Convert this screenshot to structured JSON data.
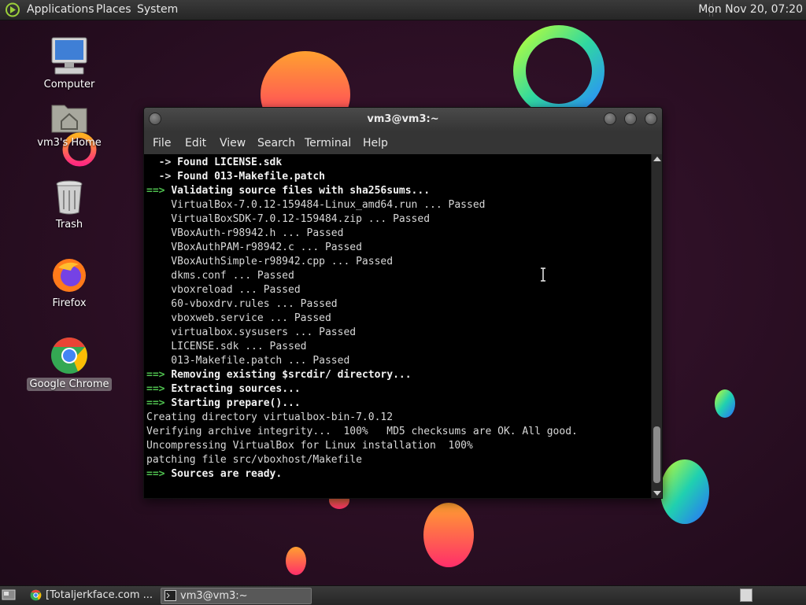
{
  "top_panel": {
    "menus": [
      "Applications",
      "Places",
      "System"
    ],
    "clock": "Mon Nov 20, 07:20"
  },
  "desktop": {
    "icons": [
      {
        "label": "Computer",
        "icon": "computer-icon"
      },
      {
        "label": "vm3's Home",
        "icon": "home-folder-icon"
      },
      {
        "label": "Trash",
        "icon": "trash-icon"
      },
      {
        "label": "Firefox",
        "icon": "firefox-icon"
      },
      {
        "label": "Google Chrome",
        "icon": "chrome-icon",
        "selected": true
      }
    ]
  },
  "terminal": {
    "title": "vm3@vm3:~",
    "menu": [
      "File",
      "Edit",
      "View",
      "Search",
      "Terminal",
      "Help"
    ],
    "lines": [
      {
        "prefix": "  -> ",
        "text": "Found LICENSE.sdk",
        "style": "sub"
      },
      {
        "prefix": "  -> ",
        "text": "Found 013-Makefile.patch",
        "style": "sub"
      },
      {
        "prefix": "==> ",
        "text": "Validating source files with sha256sums...",
        "style": "step"
      },
      {
        "prefix": "",
        "text": "    VirtualBox-7.0.12-159484-Linux_amd64.run ... Passed",
        "style": "plain"
      },
      {
        "prefix": "",
        "text": "    VirtualBoxSDK-7.0.12-159484.zip ... Passed",
        "style": "plain"
      },
      {
        "prefix": "",
        "text": "    VBoxAuth-r98942.h ... Passed",
        "style": "plain"
      },
      {
        "prefix": "",
        "text": "    VBoxAuthPAM-r98942.c ... Passed",
        "style": "plain"
      },
      {
        "prefix": "",
        "text": "    VBoxAuthSimple-r98942.cpp ... Passed",
        "style": "plain"
      },
      {
        "prefix": "",
        "text": "    dkms.conf ... Passed",
        "style": "plain"
      },
      {
        "prefix": "",
        "text": "    vboxreload ... Passed",
        "style": "plain"
      },
      {
        "prefix": "",
        "text": "    60-vboxdrv.rules ... Passed",
        "style": "plain"
      },
      {
        "prefix": "",
        "text": "    vboxweb.service ... Passed",
        "style": "plain"
      },
      {
        "prefix": "",
        "text": "    virtualbox.sysusers ... Passed",
        "style": "plain"
      },
      {
        "prefix": "",
        "text": "    LICENSE.sdk ... Passed",
        "style": "plain"
      },
      {
        "prefix": "",
        "text": "    013-Makefile.patch ... Passed",
        "style": "plain"
      },
      {
        "prefix": "==> ",
        "text": "Removing existing $srcdir/ directory...",
        "style": "step"
      },
      {
        "prefix": "==> ",
        "text": "Extracting sources...",
        "style": "step"
      },
      {
        "prefix": "==> ",
        "text": "Starting prepare()...",
        "style": "step"
      },
      {
        "prefix": "",
        "text": "Creating directory virtualbox-bin-7.0.12",
        "style": "plain"
      },
      {
        "prefix": "",
        "text": "Verifying archive integrity...  100%   MD5 checksums are OK. All good.",
        "style": "plain"
      },
      {
        "prefix": "",
        "text": "Uncompressing VirtualBox for Linux installation  100%",
        "style": "plain"
      },
      {
        "prefix": "",
        "text": "patching file src/vboxhost/Makefile",
        "style": "plain"
      },
      {
        "prefix": "==> ",
        "text": "Sources are ready.",
        "style": "step"
      }
    ]
  },
  "taskbar": {
    "tasks": [
      {
        "label": "[Totaljerkface.com ...",
        "icon": "chrome-icon",
        "active": false
      },
      {
        "label": "vm3@vm3:~",
        "icon": "terminal-icon",
        "active": true
      }
    ]
  },
  "colors": {
    "prompt_arrow": "#4fc14f",
    "terminal_bg": "#000000",
    "desktop_bg": "#2a0f22"
  }
}
